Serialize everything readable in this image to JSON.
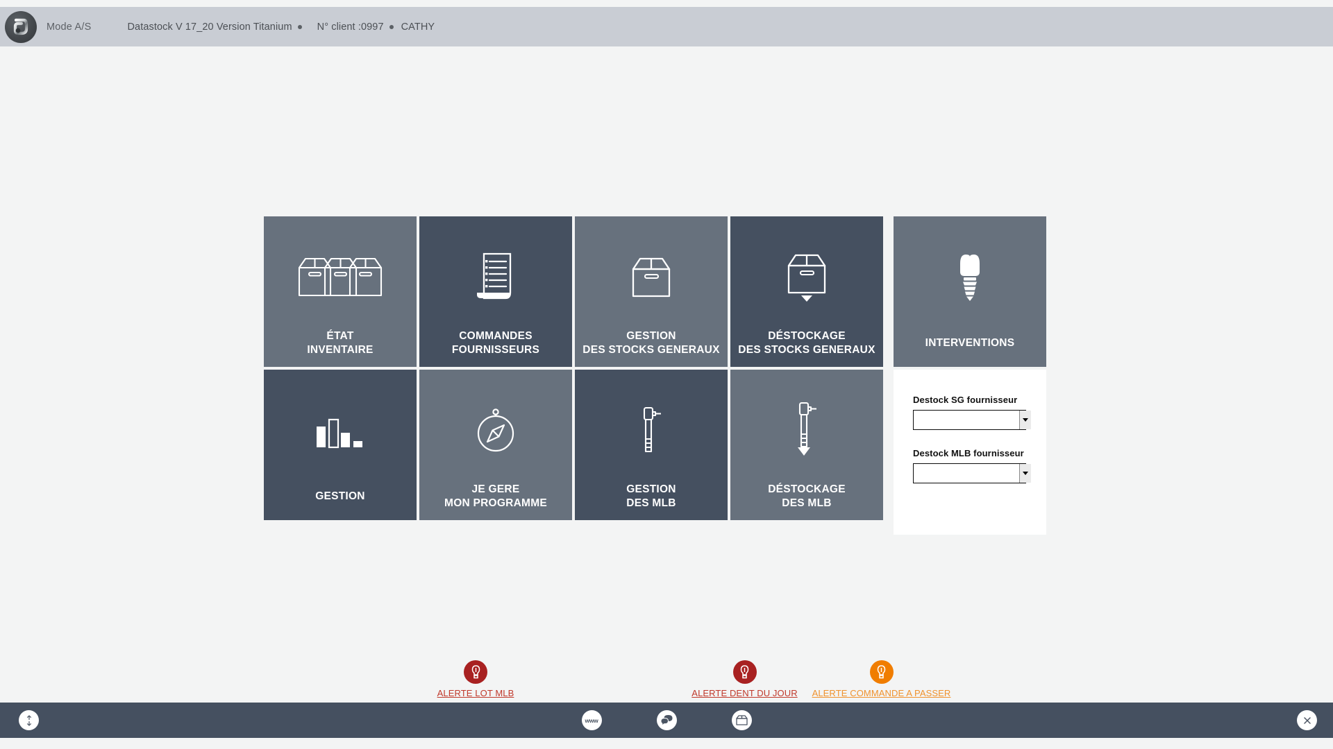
{
  "header": {
    "logo_icon": "chrome-orb-logo",
    "mode_label": "Mode A/S",
    "app_version": "Datastock V 17_20 Version Titanium",
    "client": "N° client :0997",
    "user": "CATHY"
  },
  "tiles": {
    "row1": [
      {
        "label_line1": "ÉTAT",
        "label_line2": "INVENTAIRE",
        "icon": "three-boxes-icon",
        "theme": "light"
      },
      {
        "label_line1": "COMMANDES",
        "label_line2": "FOURNISSEURS",
        "icon": "scroll-list-icon",
        "theme": "dark"
      },
      {
        "label_line1": "GESTION",
        "label_line2": "DES STOCKS GENERAUX",
        "icon": "box-icon",
        "theme": "light"
      },
      {
        "label_line1": "DÉSTOCKAGE",
        "label_line2": "DES STOCKS GENERAUX",
        "icon": "box-arrow-down-icon",
        "theme": "dark"
      }
    ],
    "row2": [
      {
        "label_line1": "GESTION",
        "label_line2": "",
        "icon": "bar-chart-icon",
        "theme": "dark"
      },
      {
        "label_line1": "JE GERE",
        "label_line2": "MON PROGRAMME",
        "icon": "compass-icon",
        "theme": "light"
      },
      {
        "label_line1": "GESTION",
        "label_line2": "DES MLB",
        "icon": "handpiece-icon",
        "theme": "dark"
      },
      {
        "label_line1": "DÉSTOCKAGE",
        "label_line2": "DES MLB",
        "icon": "handpiece-arrow-down-icon",
        "theme": "light"
      }
    ],
    "interventions": {
      "label": "INTERVENTIONS",
      "icon": "dental-implant-icon",
      "theme": "light"
    }
  },
  "panel": {
    "destock_sg": {
      "label": "Destock SG fournisseur",
      "value": "",
      "options": [
        ""
      ]
    },
    "destock_mlb": {
      "label": "Destock MLB fournisseur",
      "value": "",
      "options": [
        ""
      ]
    }
  },
  "alerts": [
    {
      "text": "ALERTE LOT MLB",
      "icon": "lightbulb-icon",
      "color": "#a82121"
    },
    {
      "text": "ALERTE DENT DU JOUR",
      "icon": "lightbulb-icon",
      "color": "#a82121"
    },
    {
      "text": "ALERTE COMMANDE A PASSER",
      "icon": "lightbulb-icon",
      "color": "#f07d00"
    }
  ],
  "taskbar": {
    "updown_icon": "up-down-arrows-icon",
    "www_icon": "www",
    "chat_icon": "chat-bubble-icon",
    "box_icon": "box-icon",
    "close_icon": "close-icon"
  },
  "colors": {
    "tile_light": "#67717d",
    "tile_dark": "#455060",
    "header_bg": "#c9cdd4",
    "taskbar_bg": "#455060",
    "page_bg": "#f3f4f4",
    "alert_red": "#a82121",
    "alert_orange": "#f07d00"
  }
}
